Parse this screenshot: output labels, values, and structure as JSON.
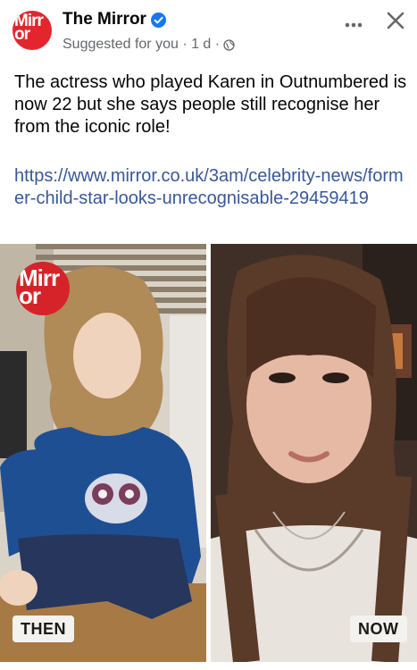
{
  "header": {
    "page_name": "The Mirror",
    "meta_text": "Suggested for you · 1 d ·",
    "avatar_logo": "Mirror",
    "icons": {
      "verified": "verified-badge-icon",
      "globe": "globe-icon",
      "more": "more-options-icon",
      "close": "close-icon"
    }
  },
  "post": {
    "text": "The actress who played Karen in Outnumbered is now 22 but she says people still recognise her from the iconic role!",
    "link": "https://www.mirror.co.uk/3am/celebrity-news/former-child-star-looks-unrecognisable-29459419"
  },
  "photos": {
    "left_tag": "THEN",
    "right_tag": "NOW",
    "badge_logo": "Mirror"
  },
  "colors": {
    "brand_red": "#e3262d",
    "verified_blue": "#1877f2",
    "link_blue": "#385898",
    "meta_gray": "#65676b"
  }
}
